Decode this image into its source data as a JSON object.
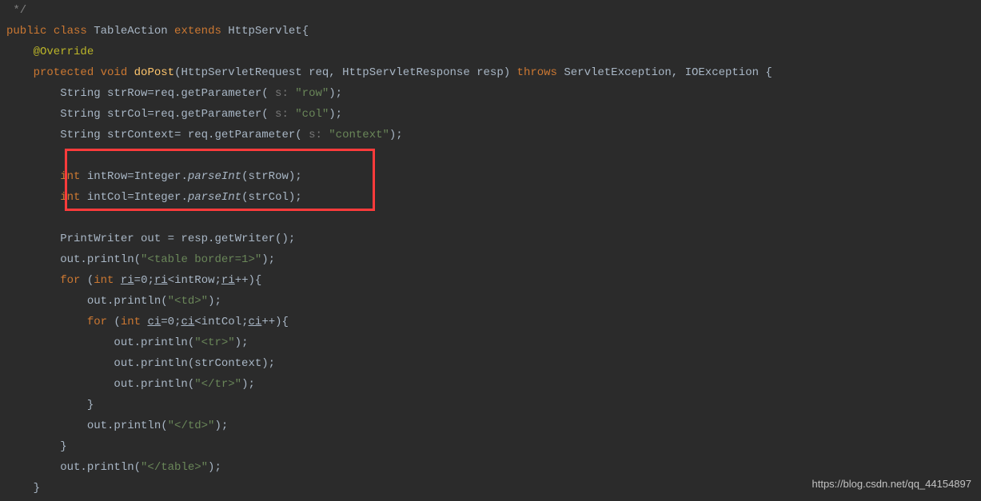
{
  "code": {
    "l0": " */",
    "l1_public": "public",
    "l1_class": " class ",
    "l1_name": "TableAction",
    "l1_extends": " extends ",
    "l1_parent": "HttpServlet{",
    "l2_annotation": "    @Override",
    "l3_protected": "    protected",
    "l3_void": " void ",
    "l3_method": "doPost",
    "l3_sig1": "(HttpServletRequest req, HttpServletResponse resp) ",
    "l3_throws": "throws ",
    "l3_exc": "ServletException, IOException {",
    "l4_pre": "        String strRow=req.getParameter(",
    "l4_hint": " s: ",
    "l4_str": "\"row\"",
    "l4_post": ");",
    "l5_pre": "        String strCol=req.getParameter(",
    "l5_hint": " s: ",
    "l5_str": "\"col\"",
    "l5_post": ");",
    "l6_pre": "        String strContext= req.getParameter(",
    "l6_hint": " s: ",
    "l6_str": "\"context\"",
    "l6_post": ");",
    "l7": "",
    "l8_int": "        int",
    "l8_var": " intRow=Integer.",
    "l8_method": "parseInt",
    "l8_arg": "(strRow);",
    "l9_int": "        int",
    "l9_var": " intCol=Integer.",
    "l9_method": "parseInt",
    "l9_arg": "(strCol);",
    "l10": "",
    "l11": "        PrintWriter out = resp.getWriter();",
    "l12_pre": "        out.println(",
    "l12_str": "\"<table border=1>\"",
    "l12_post": ");",
    "l13_for": "        for ",
    "l13_open": "(",
    "l13_int": "int ",
    "l13_ri": "ri",
    "l13_eq": "=",
    "l13_zero": "0",
    "l13_semi": ";",
    "l13_ri2": "ri",
    "l13_cond": "<intRow;",
    "l13_ri3": "ri",
    "l13_inc": "++){",
    "l14_pre": "            out.println(",
    "l14_str": "\"<td>\"",
    "l14_post": ");",
    "l15_for": "            for ",
    "l15_open": "(",
    "l15_int": "int ",
    "l15_ci": "ci",
    "l15_eq": "=",
    "l15_zero": "0",
    "l15_semi": ";",
    "l15_ci2": "ci",
    "l15_cond": "<intCol;",
    "l15_ci3": "ci",
    "l15_inc": "++){",
    "l16_pre": "                out.println(",
    "l16_str": "\"<tr>\"",
    "l16_post": ");",
    "l17": "                out.println(strContext);",
    "l18_pre": "                out.println(",
    "l18_str": "\"</tr>\"",
    "l18_post": ");",
    "l19": "            }",
    "l20_pre": "            out.println(",
    "l20_str": "\"</td>\"",
    "l20_post": ");",
    "l21": "        }",
    "l22_pre": "        out.println(",
    "l22_str": "\"</table>\"",
    "l22_post": ");",
    "l23": "    }"
  },
  "watermark": "https://blog.csdn.net/qq_44154897"
}
